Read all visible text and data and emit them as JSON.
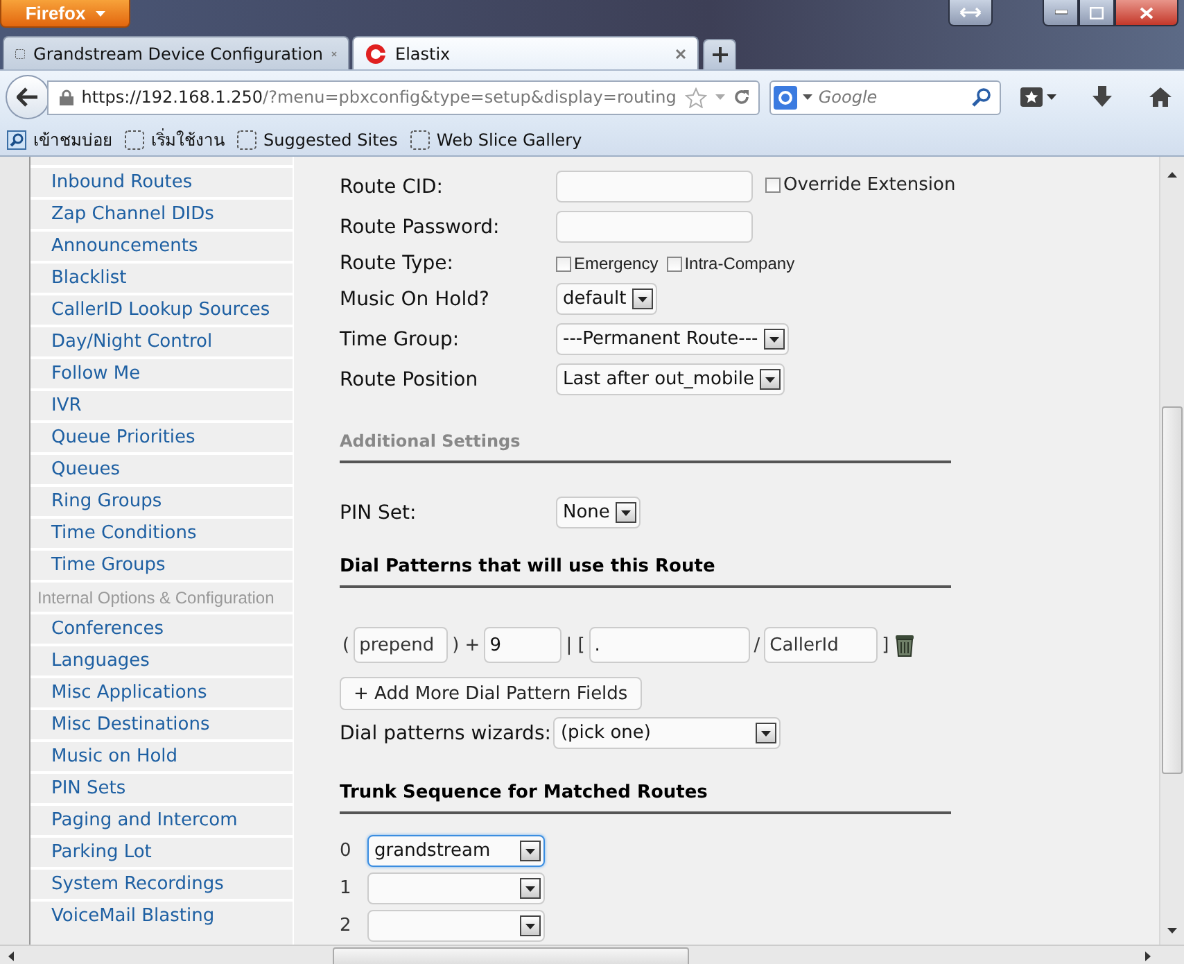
{
  "window": {
    "menu_button": "Firefox"
  },
  "tabs": [
    {
      "title": "Grandstream Device Configuration",
      "kind": "blank",
      "selected": false
    },
    {
      "title": "Elastix",
      "kind": "elastix",
      "selected": true
    }
  ],
  "address_bar": {
    "host": "https://192.168.1.250",
    "path": "/?menu=pbxconfig&type=setup&display=routing"
  },
  "search_field": {
    "placeholder": "Google"
  },
  "bookmarks": [
    {
      "label": "เข้าชมบ่อย",
      "kind": "search"
    },
    {
      "label": "เริ่มใช้งาน",
      "kind": "blank"
    },
    {
      "label": "Suggested Sites",
      "kind": "blank"
    },
    {
      "label": "Web Slice Gallery",
      "kind": "blank"
    }
  ],
  "sidebar": {
    "items": [
      {
        "label": "Inbound Routes",
        "kind": "link"
      },
      {
        "label": "Zap Channel DIDs",
        "kind": "link"
      },
      {
        "label": "Announcements",
        "kind": "link"
      },
      {
        "label": "Blacklist",
        "kind": "link"
      },
      {
        "label": "CallerID Lookup Sources",
        "kind": "link"
      },
      {
        "label": "Day/Night Control",
        "kind": "link"
      },
      {
        "label": "Follow Me",
        "kind": "link"
      },
      {
        "label": "IVR",
        "kind": "link"
      },
      {
        "label": "Queue Priorities",
        "kind": "link"
      },
      {
        "label": "Queues",
        "kind": "link"
      },
      {
        "label": "Ring Groups",
        "kind": "link"
      },
      {
        "label": "Time Conditions",
        "kind": "link"
      },
      {
        "label": "Time Groups",
        "kind": "link"
      },
      {
        "label": "Internal Options & Configuration",
        "kind": "heading"
      },
      {
        "label": "Conferences",
        "kind": "link"
      },
      {
        "label": "Languages",
        "kind": "link"
      },
      {
        "label": "Misc Applications",
        "kind": "link"
      },
      {
        "label": "Misc Destinations",
        "kind": "link"
      },
      {
        "label": "Music on Hold",
        "kind": "link"
      },
      {
        "label": "PIN Sets",
        "kind": "link"
      },
      {
        "label": "Paging and Intercom",
        "kind": "link"
      },
      {
        "label": "Parking Lot",
        "kind": "link"
      },
      {
        "label": "System Recordings",
        "kind": "link"
      },
      {
        "label": "VoiceMail Blasting",
        "kind": "link"
      }
    ]
  },
  "route_settings": [
    {
      "kind": "text",
      "label": "Route CID:",
      "option": {
        "label": "Override Extension",
        "checked": false
      }
    },
    {
      "kind": "text",
      "label": "Route Password:"
    },
    {
      "kind": "checkboxes",
      "label": "Route Type:",
      "options": [
        {
          "label": "Emergency",
          "checked": false
        },
        {
          "label": "Intra-Company",
          "checked": false
        }
      ]
    },
    {
      "kind": "select",
      "label": "Music On Hold?",
      "value": "default"
    },
    {
      "kind": "select",
      "label": "Time Group:",
      "value": "---Permanent Route---"
    },
    {
      "kind": "select",
      "label": "Route Position",
      "value": "Last after out_mobile"
    }
  ],
  "additional_settings": {
    "heading": "Additional Settings",
    "pin_set": {
      "label": "PIN Set:",
      "value": "None"
    }
  },
  "dial_patterns": {
    "heading": "Dial Patterns that will use this Route",
    "pattern": {
      "open": "(",
      "prepend_placeholder": "prepend",
      "close_plus": ") +",
      "prefix": "9",
      "bar_bracket": "| [",
      "match": ".",
      "slash": "/",
      "callerid_placeholder": "CallerId",
      "end": "]"
    },
    "add_button": "+ Add More Dial Pattern Fields",
    "wizard": {
      "label": "Dial patterns wizards:",
      "value": "(pick one)"
    }
  },
  "trunk_sequence": {
    "heading": "Trunk Sequence for Matched Routes",
    "rows": [
      {
        "index": "0",
        "value": "grandstream",
        "focused": true
      },
      {
        "index": "1",
        "focused": false
      },
      {
        "index": "2",
        "focused": false
      }
    ]
  }
}
